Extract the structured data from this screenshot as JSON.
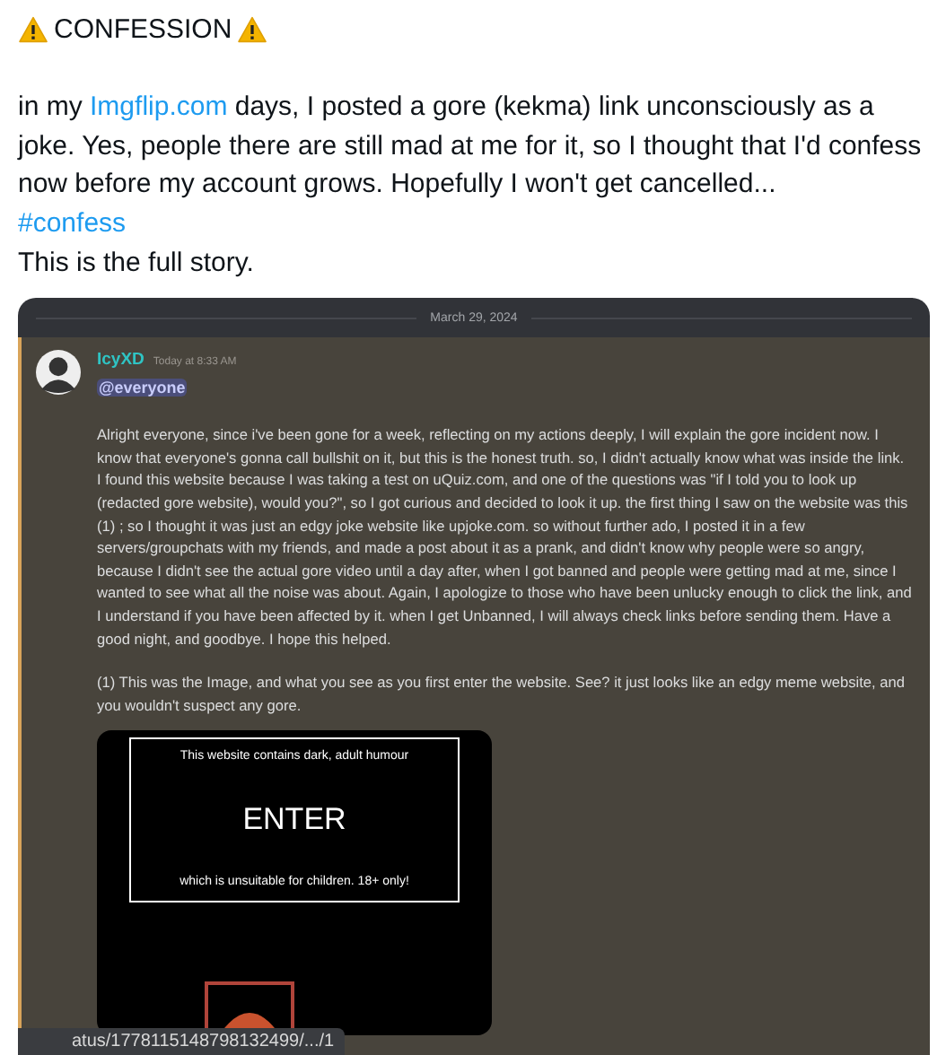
{
  "post": {
    "title": "CONFESSION",
    "text_before": "in my ",
    "link": "Imgflip.com",
    "text_after": " days, I posted a gore (kekma) link unconsciously as a joke. Yes, people there are still mad at me for it, so I thought that I'd confess now before my account grows. Hopefully I won't get cancelled...",
    "hashtag": "#confess",
    "closing": "This is the full story."
  },
  "screenshot": {
    "date": "March 29, 2024",
    "message": {
      "username": "IcyXD",
      "timestamp": "Today at 8:33 AM",
      "mention": "@everyone",
      "highlighted": true,
      "paragraphs": [
        "Alright everyone, since i've been gone for a week, reflecting on my actions deeply, I will explain the gore incident now. I know that everyone's gonna call bullshit on it, but this is the honest truth. so, I didn't actually know what was inside the link. I found this website because I was taking a test on uQuiz.com, and one of the questions was \"if I told you to look up (redacted gore website), would you?\", so I got curious and decided to look it up. the first thing I saw on the website was this (1) ; so I thought it was just an edgy joke website like upjoke.com. so without further ado, I posted it in a few servers/groupchats with my friends, and made a post about it as a prank, and didn't know why people were so angry, because I didn't see the actual gore video until a day after, when I got banned and people were getting mad at me, since I wanted to see what all the noise was about. Again, I apologize to those who have been unlucky enough to click the link, and I understand if you have been affected by it. when I get Unbanned, I will always check links before sending them. Have a good night, and goodbye. I hope this helped.",
        "(1) This was the Image, and what you see as you first enter the website. See? it just looks like an edgy meme website, and you wouldn't suspect any gore."
      ],
      "image": {
        "warning": "This website contains dark, adult humour",
        "button": "ENTER",
        "notice": "which is unsuitable for children. 18+ only!"
      }
    },
    "url": "atus/1778115148798132499/.../1"
  }
}
